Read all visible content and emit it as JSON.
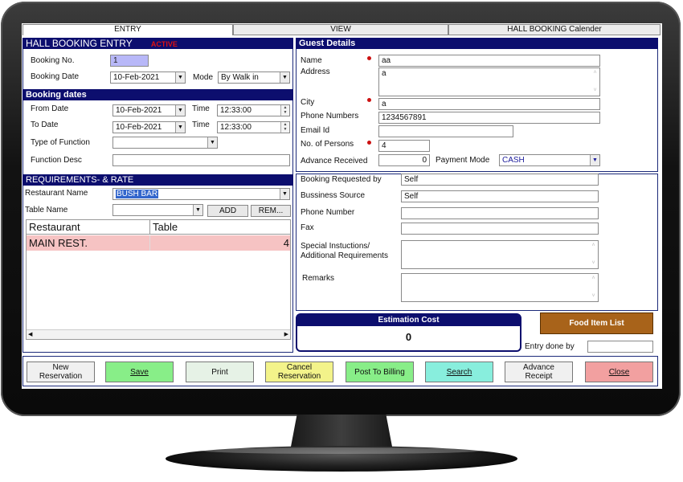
{
  "tabs": [
    "ENTRY",
    "VIEW",
    "HALL BOOKING Calender"
  ],
  "hall": {
    "title": "HALL BOOKING ENTRY",
    "status": "ACTIVE",
    "booking_no_label": "Booking No.",
    "booking_no": "1",
    "booking_date_label": "Booking Date",
    "booking_date": "10-Feb-2021",
    "mode_label": "Mode",
    "mode": "By Walk in"
  },
  "dates": {
    "title": "Booking  dates",
    "from_label": "From Date",
    "from": "10-Feb-2021",
    "to_label": "To Date",
    "to": "10-Feb-2021",
    "time_label": "Time",
    "from_time": "12:33:00",
    "to_time": "12:33:00",
    "type_label": "Type of Function",
    "type": "",
    "desc_label": "Function Desc",
    "desc": ""
  },
  "req": {
    "title": "REQUIREMENTS- & RATE",
    "restaurant_label": "Restaurant Name",
    "restaurant": "BUSH BAR",
    "table_label": "Table Name",
    "table": "",
    "add": "ADD",
    "rem": "REM...",
    "columns": [
      "Restaurant",
      "Table"
    ],
    "rows": [
      {
        "restaurant": "MAIN REST.",
        "table": "4"
      }
    ]
  },
  "guest": {
    "title": "Guest Details",
    "name_label": "Name",
    "name": "aa",
    "address_label": "Address",
    "address": "a",
    "city_label": "City",
    "city": "a",
    "phone_label": "Phone Numbers",
    "phone": "1234567891",
    "email_label": "Email Id",
    "email": "",
    "persons_label": "No. of Persons",
    "persons": "4",
    "advance_label": "Advance Received",
    "advance": "0",
    "payment_label": "Payment Mode",
    "payment": "CASH"
  },
  "source": {
    "requested_label": "Booking Requested by",
    "requested": "Self",
    "business_label": "Bussiness Source",
    "business": "Self",
    "phone_label": "Phone Number",
    "phone": "",
    "fax_label": "Fax",
    "fax": "",
    "special_label1": "Special Instuctions/",
    "special_label2": "Additional Requirements",
    "special": "",
    "remarks_label": "Remarks",
    "remarks": ""
  },
  "estimation": {
    "title": "Estimation Cost",
    "value": "0"
  },
  "food_btn": "Food Item List",
  "entry_done_label": "Entry done by",
  "buttons": {
    "new1": "New",
    "new2": "Reservation",
    "save": "Save",
    "print": "Print",
    "cancel1": "Cancel",
    "cancel2": "Reservation",
    "post": "Post To Billing",
    "search": "Search",
    "adv1": "Advance",
    "adv2": "Receipt",
    "close": "Close"
  },
  "colors": {
    "section_header": "#0c0e6e",
    "active_red": "#dd1111",
    "grid_row": "#f6c3c3",
    "food_btn": "#a8631a",
    "save_btn": "#88ee88",
    "cancel_btn": "#f3f38a",
    "post_btn": "#88ee88",
    "search_btn": "#88eedd",
    "close_btn": "#f2a0a0"
  }
}
